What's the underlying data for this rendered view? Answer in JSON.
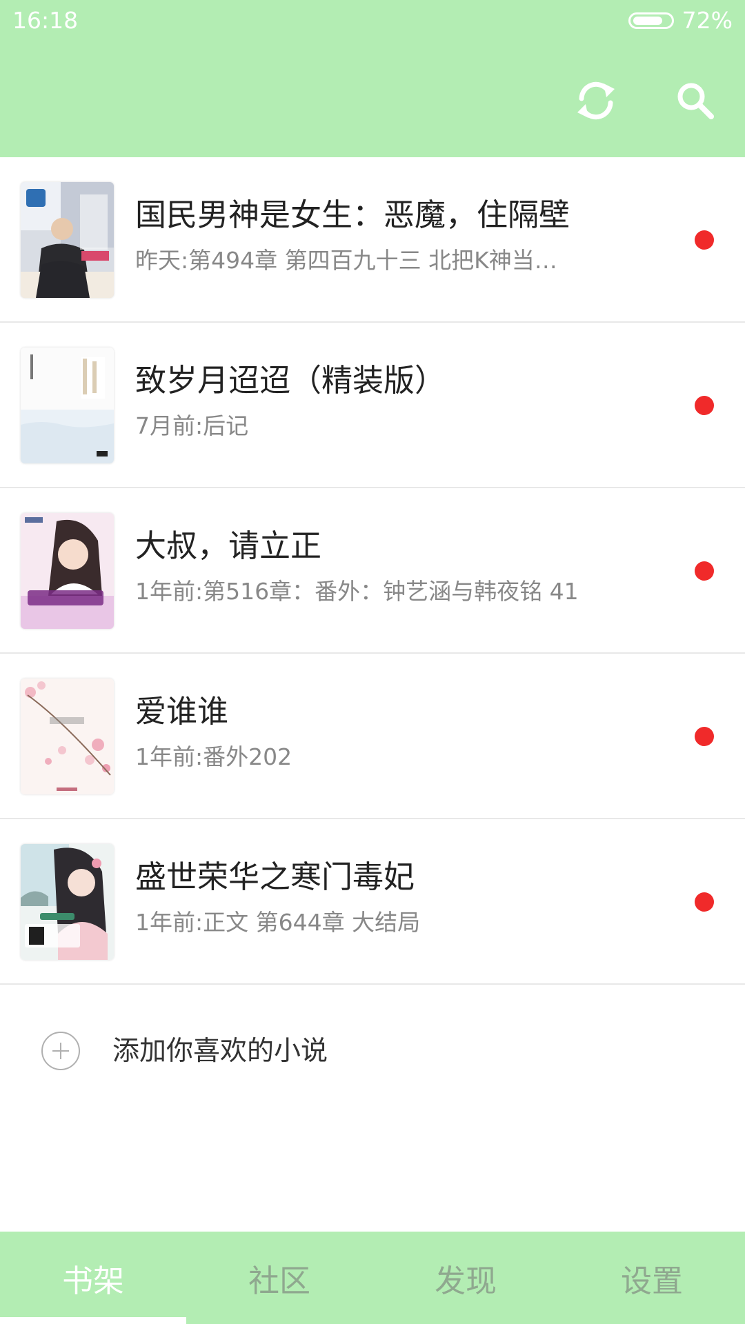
{
  "status_bar": {
    "time": "16:18",
    "battery_percent": "72%",
    "battery_level": 0.72
  },
  "header": {
    "icons": [
      "refresh-icon",
      "search-icon"
    ]
  },
  "books": [
    {
      "title": "国民男神是女生：恶魔，住隔壁",
      "update": "昨天:第494章 第四百九十三 北把K神当…",
      "unread": true
    },
    {
      "title": "致岁月迢迢（精装版）",
      "update": "7月前:后记",
      "unread": true
    },
    {
      "title": "大叔，请立正",
      "update": "1年前:第516章：番外：钟艺涵与韩夜铭 41",
      "unread": true
    },
    {
      "title": "爱谁谁",
      "update": "1年前:番外202",
      "unread": true
    },
    {
      "title": "盛世荣华之寒门毒妃",
      "update": "1年前:正文 第644章 大结局",
      "unread": true
    }
  ],
  "add_novel": {
    "label": "添加你喜欢的小说"
  },
  "bottom_nav": {
    "tabs": [
      "书架",
      "社区",
      "发现",
      "设置"
    ],
    "active": "书架"
  },
  "colors": {
    "theme_green": "#b3edb3",
    "unread_dot": "#f02a2a",
    "inactive_tab": "#8fa88f"
  }
}
